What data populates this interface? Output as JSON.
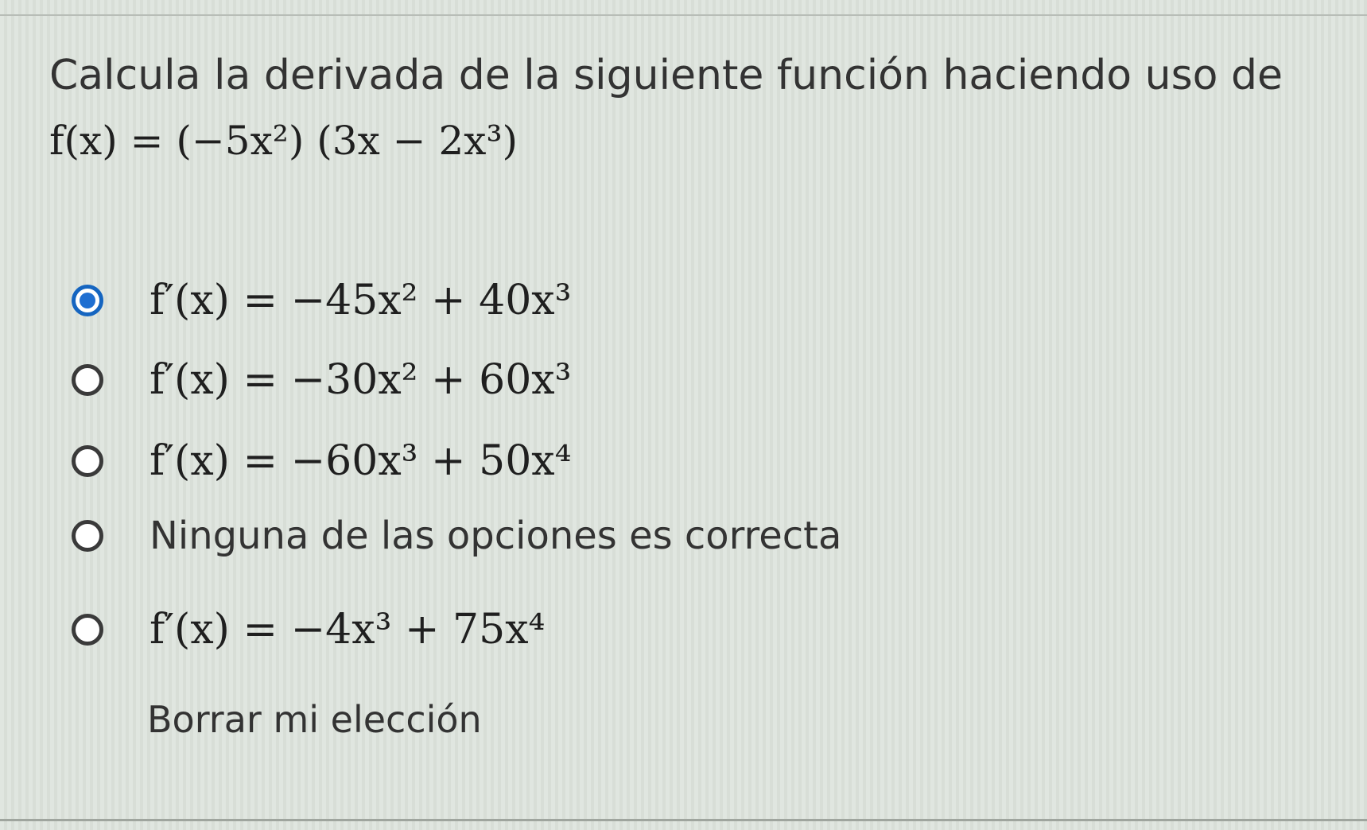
{
  "question": {
    "text": "Calcula la derivada de la siguiente función haciendo uso de",
    "function_expression": "f(x) = (−5x²) (3x − 2x³)"
  },
  "options": [
    {
      "text": "f′(x) = −45x² + 40x³",
      "selected": true
    },
    {
      "text": "f′(x) = −30x² + 60x³",
      "selected": false
    },
    {
      "text": "f′(x) = −60x³ + 50x⁴",
      "selected": false
    },
    {
      "text": "Ninguna de las opciones es correcta",
      "selected": false
    },
    {
      "text": "f′(x) = −4x³ + 75x⁴",
      "selected": false
    }
  ],
  "clear_choice": "Borrar mi elección",
  "colors": {
    "background": "#dde3dc",
    "selected_radio": "#1f6fd1",
    "text": "#333333"
  }
}
